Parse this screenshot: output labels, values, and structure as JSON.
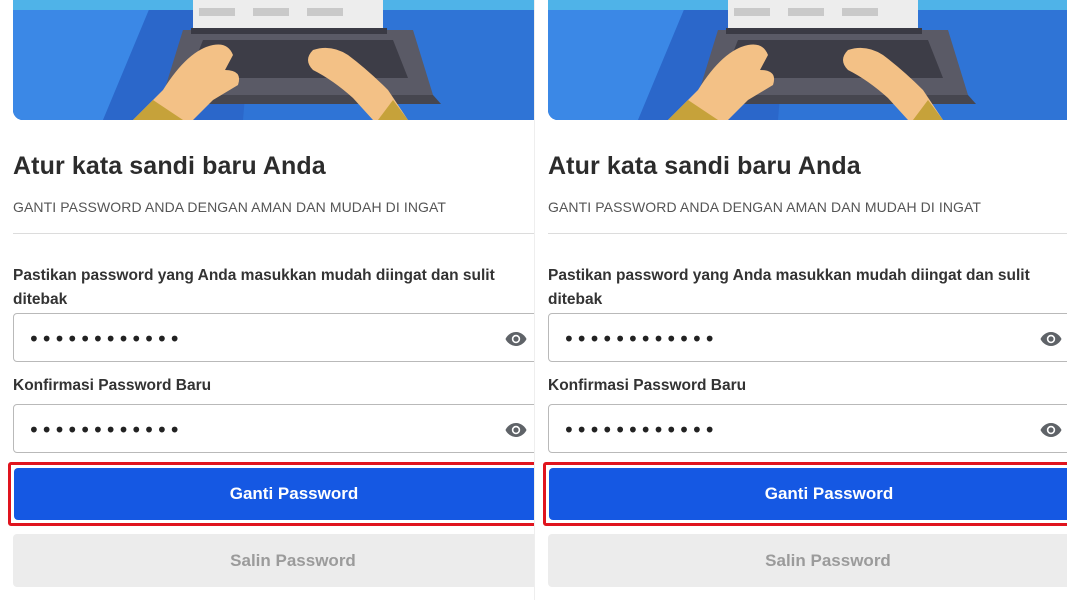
{
  "panels": [
    {
      "title": "Atur kata sandi baru Anda",
      "subtitle": "GANTI PASSWORD ANDA DENGAN AMAN DAN MUDAH DI INGAT",
      "password_label": "Pastikan password yang Anda masukkan mudah diingat dan sulit ditebak",
      "password_value": "••••••••••••",
      "confirm_label": "Konfirmasi Password Baru",
      "confirm_value": "••••••••••••",
      "primary_button": "Ganti Password",
      "secondary_button": "Salin Password",
      "eye_icon": "eye-icon"
    },
    {
      "title": "Atur kata sandi baru Anda",
      "subtitle": "GANTI PASSWORD ANDA DENGAN AMAN DAN MUDAH DI INGAT",
      "password_label": "Pastikan password yang Anda masukkan mudah diingat dan sulit ditebak",
      "password_value": "••••••••••••",
      "confirm_label": "Konfirmasi Password Baru",
      "confirm_value": "••••••••••••",
      "primary_button": "Ganti Password",
      "secondary_button": "Salin Password",
      "eye_icon": "eye-icon"
    }
  ],
  "colors": {
    "primary": "#1558e3",
    "highlight": "#e0141e",
    "secondary_bg": "#ececec",
    "secondary_text": "#9b9b9b",
    "banner_bg": "#2f74d6"
  }
}
